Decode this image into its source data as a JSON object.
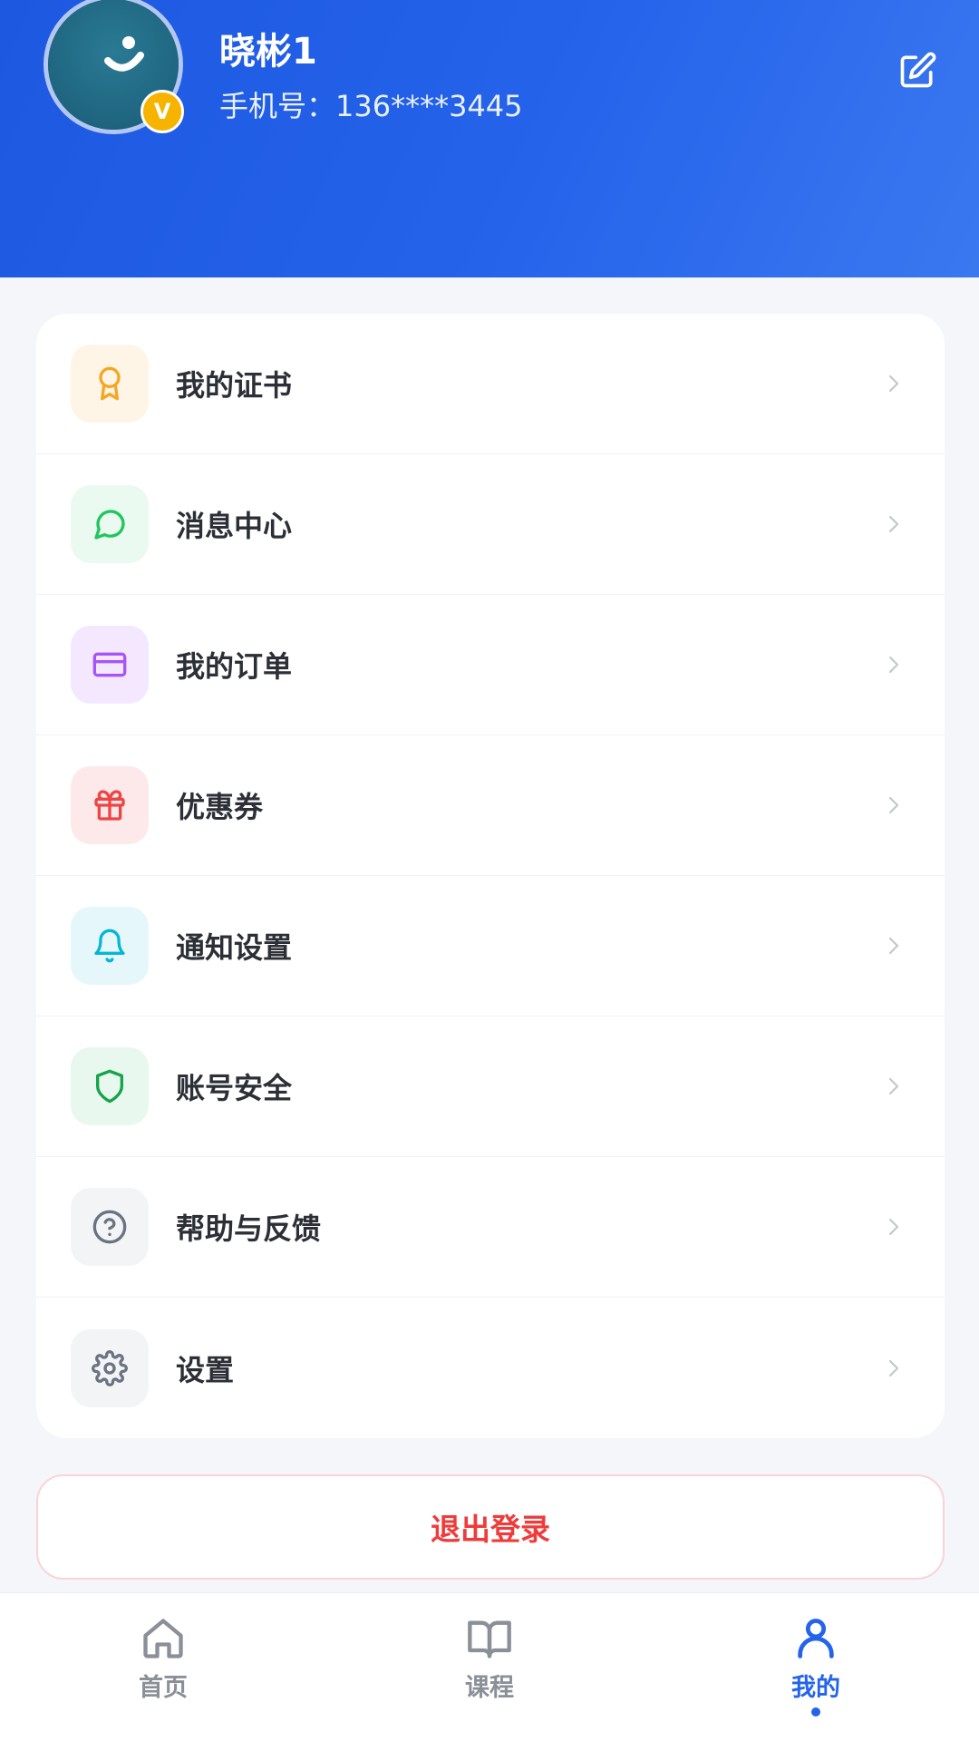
{
  "profile": {
    "name": "晓彬1",
    "phone": "手机号：136****3445",
    "badge": "V"
  },
  "menu": [
    {
      "label": "我的证书",
      "icon": "award-icon",
      "bg": "#fff5e6",
      "color": "#f5a623"
    },
    {
      "label": "消息中心",
      "icon": "message-icon",
      "bg": "#eafaf0",
      "color": "#22c55e"
    },
    {
      "label": "我的订单",
      "icon": "card-icon",
      "bg": "#f3e8ff",
      "color": "#a855f7"
    },
    {
      "label": "优惠券",
      "icon": "gift-icon",
      "bg": "#fee9ea",
      "color": "#ef4444"
    },
    {
      "label": "通知设置",
      "icon": "bell-icon",
      "bg": "#e6f7fb",
      "color": "#06b6d4"
    },
    {
      "label": "账号安全",
      "icon": "shield-icon",
      "bg": "#e8f8ee",
      "color": "#16a34a"
    },
    {
      "label": "帮助与反馈",
      "icon": "help-icon",
      "bg": "#f3f4f6",
      "color": "#6b7280"
    },
    {
      "label": "设置",
      "icon": "gear-icon",
      "bg": "#f3f4f6",
      "color": "#6b7280"
    }
  ],
  "logout": {
    "label": "退出登录"
  },
  "nav": {
    "items": [
      {
        "label": "首页",
        "icon": "home-icon"
      },
      {
        "label": "课程",
        "icon": "book-icon"
      },
      {
        "label": "我的",
        "icon": "user-icon"
      }
    ],
    "active_index": 2
  },
  "colors": {
    "primary": "#2563eb",
    "danger": "#ef3b3b"
  }
}
